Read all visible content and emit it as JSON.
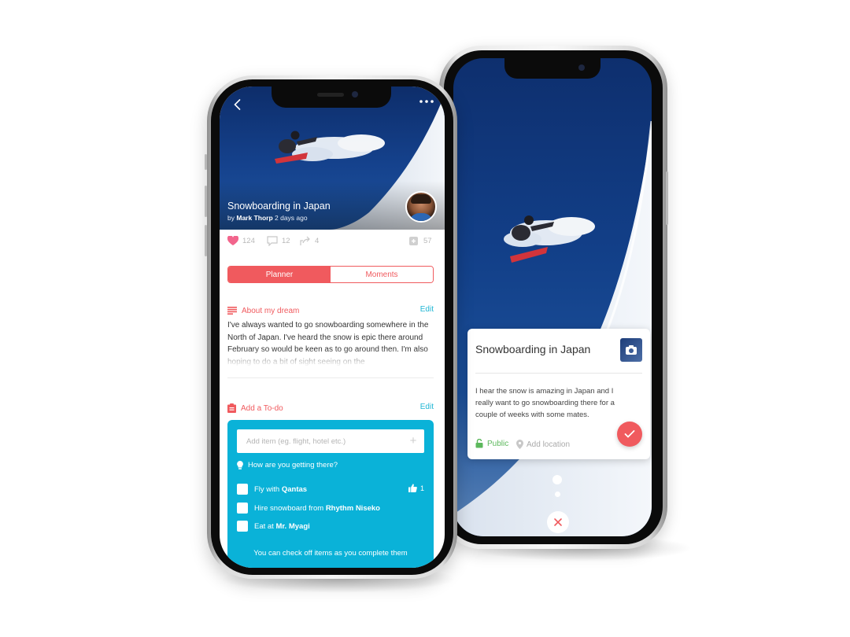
{
  "left_phone": {
    "hero": {
      "title": "Snowboarding in Japan",
      "by_prefix": "by",
      "author": "Mark Thorp",
      "time": "2 days ago"
    },
    "stats": {
      "likes": "124",
      "comments": "12",
      "shares": "4",
      "saves": "57"
    },
    "tabs": [
      {
        "label": "Planner",
        "active": true
      },
      {
        "label": "Moments",
        "active": false
      }
    ],
    "about": {
      "heading": "About my dream",
      "edit_label": "Edit",
      "text": "I've always wanted to go snowboarding somewhere in the North of Japan. I've heard the snow is epic there around February so would be keen as to go around then. I'm also hoping to do a bit of sight seeing on the"
    },
    "todo": {
      "heading": "Add a To-do",
      "edit_label": "Edit",
      "input_placeholder": "Add item (eg. flight, hotel etc.)",
      "question": "How are you getting there?",
      "items": [
        {
          "prefix": "Fly with",
          "bold": "Qantas",
          "likes": "1"
        },
        {
          "prefix": "Hire snowboard from",
          "bold": "Rhythm Niseko"
        },
        {
          "prefix": "Eat at",
          "bold": "Mr. Myagi"
        }
      ],
      "footer": "You can check off items as you complete them"
    }
  },
  "right_phone": {
    "card": {
      "title": "Snowboarding in Japan",
      "body": "I hear the snow is amazing in Japan and I really want to go snowboarding there for a couple of weeks with some mates.",
      "visibility": "Public",
      "location_placeholder": "Add location"
    }
  },
  "colors": {
    "accent": "#f05a5e",
    "teal": "#0ab2d8",
    "link": "#1fb6d4",
    "public_green": "#5cb85c"
  }
}
